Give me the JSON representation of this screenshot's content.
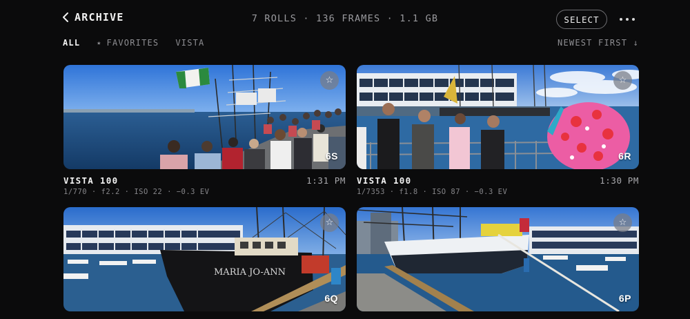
{
  "header": {
    "back_label": "ARCHIVE",
    "stats": "7 ROLLS · 136 FRAMES · 1.1 GB",
    "select_label": "SELECT"
  },
  "filters": {
    "items": [
      {
        "label": "ALL",
        "active": true
      },
      {
        "label": "FAVORITES",
        "icon": "star-icon"
      },
      {
        "label": "VISTA"
      }
    ],
    "sort_label": "NEWEST FIRST ↓"
  },
  "rolls": [
    {
      "code": "6S",
      "film": "VISTA 100",
      "time": "1:31 PM",
      "exif": "1/770 · f2.2 · ISO 22 · −0.3 EV"
    },
    {
      "code": "6R",
      "film": "VISTA 100",
      "time": "1:30 PM",
      "exif": "1/7353 · f1.8 · ISO 87 · −0.3 EV"
    },
    {
      "code": "6Q",
      "boat_name": "MARIA JO-ANN"
    },
    {
      "code": "6P"
    }
  ],
  "colors": {
    "background": "#0b0b0c",
    "accent_text": "#f4f4f4",
    "muted_text": "#8f8f93"
  }
}
